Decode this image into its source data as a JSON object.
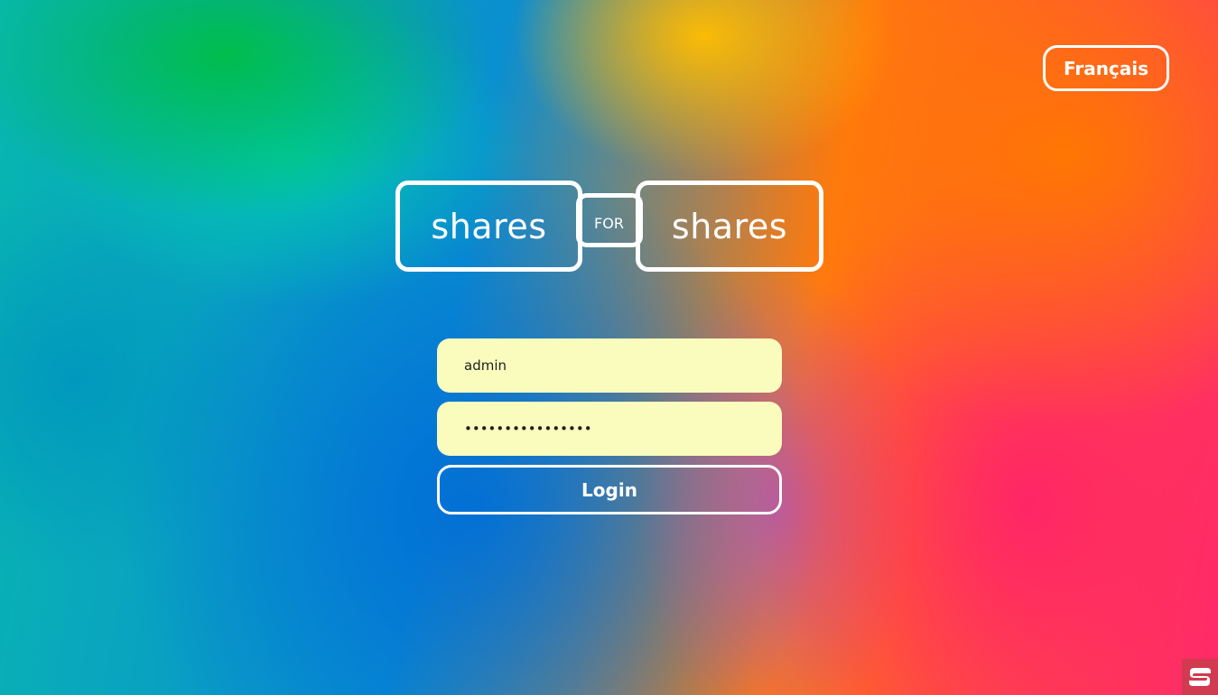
{
  "header": {
    "language_button_label": "Français"
  },
  "logo": {
    "left_word": "shares",
    "connector_word": "FOR",
    "right_word": "shares"
  },
  "login": {
    "username_value": "admin",
    "password_value": "••••••••••••••••",
    "submit_label": "Login"
  },
  "colors": {
    "field_background": "#f9fcbd",
    "button_border": "#ffffff",
    "badge_background": "#d23a4f"
  },
  "icons": {
    "corner_badge": "app-logo-icon"
  }
}
